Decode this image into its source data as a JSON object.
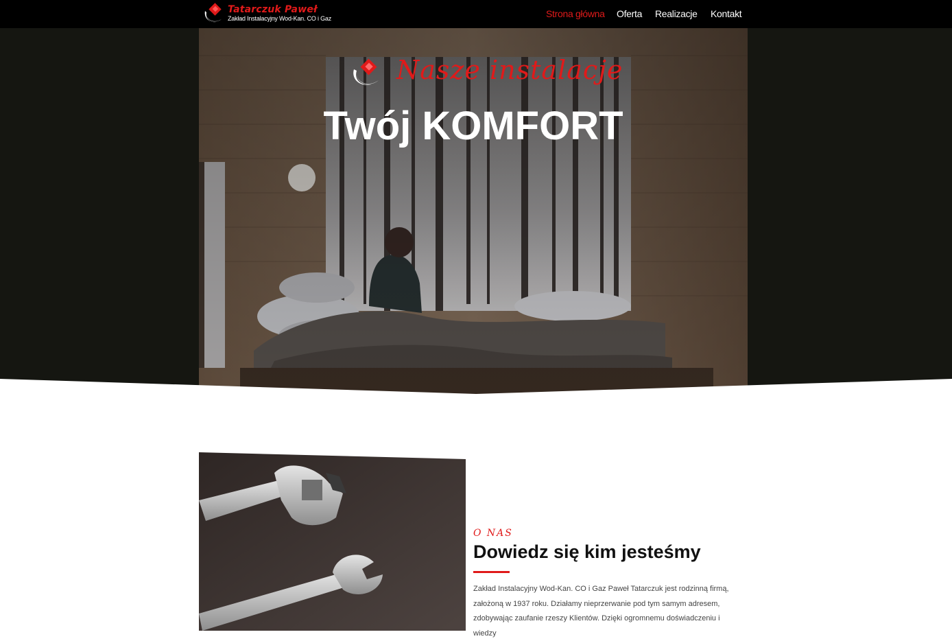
{
  "header": {
    "brand_name": "Tatarczuk Paweł",
    "brand_tagline": "Zakład Instalacyjny Wod-Kan. CO i Gaz",
    "nav": [
      {
        "label": "Strona główna",
        "active": true
      },
      {
        "label": "Oferta",
        "active": false
      },
      {
        "label": "Realizacje",
        "active": false
      },
      {
        "label": "Kontakt",
        "active": false
      }
    ]
  },
  "hero": {
    "script_title": "Nasze instalacje",
    "title": "Twój KOMFORT"
  },
  "about": {
    "kicker": "O NAS",
    "heading": "Dowiedz się kim jesteśmy",
    "text": "Zakład Instalacyjny Wod-Kan. CO i Gaz Paweł Tatarczuk jest rodzinną firmą, założoną w 1937 roku. Działamy nieprzerwanie pod tym samym adresem, zdobywając zaufanie rzeszy Klientów. Dzięki ogromnemu doświadczeniu i wiedzy"
  },
  "colors": {
    "accent": "#e01a1a",
    "header_bg": "#000000",
    "hero_bg": "#151611"
  },
  "icons": {
    "logo": "red-diamond-swoosh-logo"
  }
}
